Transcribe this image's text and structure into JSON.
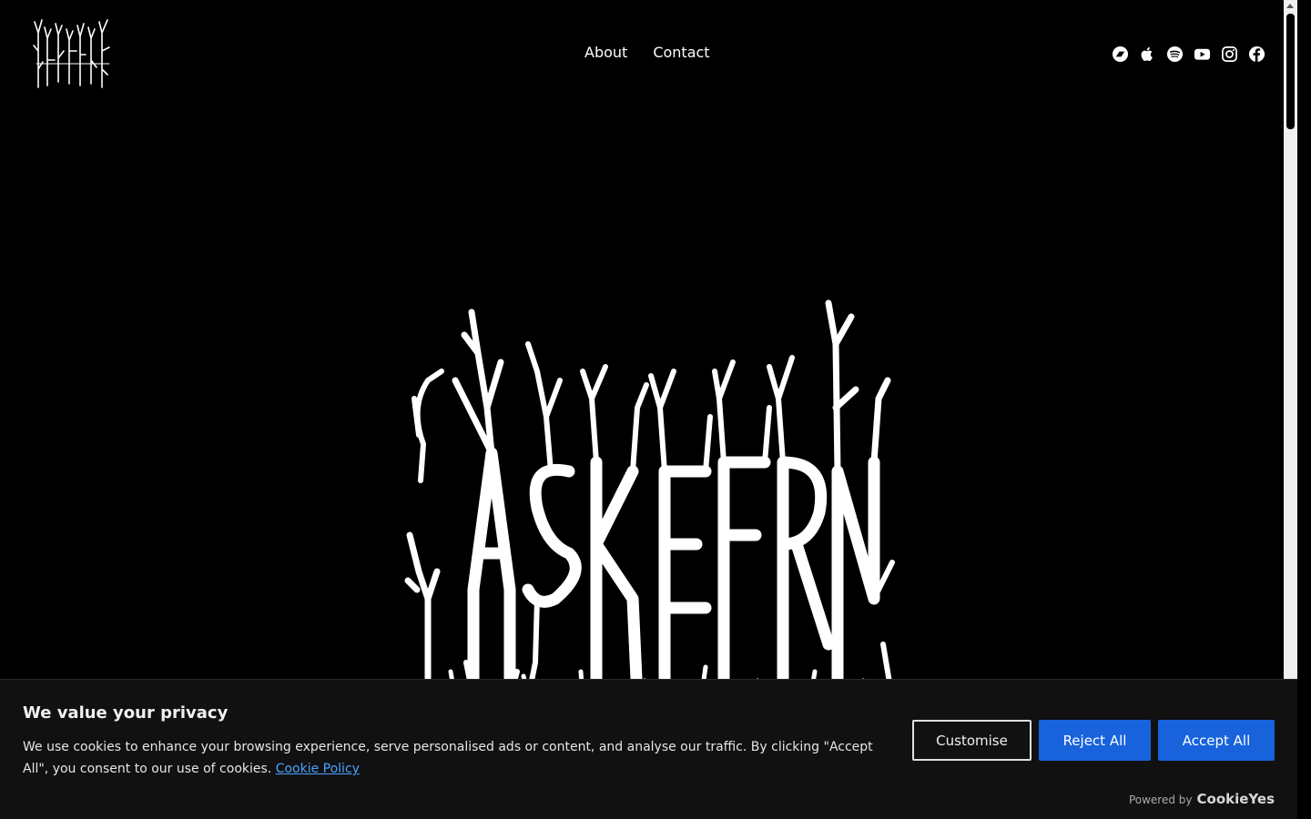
{
  "nav": {
    "about": "About",
    "contact": "Contact"
  },
  "brand": {
    "logo_text": "ASKEFRON"
  },
  "socials": [
    {
      "name": "bandcamp-icon"
    },
    {
      "name": "apple-music-icon"
    },
    {
      "name": "spotify-icon"
    },
    {
      "name": "youtube-icon"
    },
    {
      "name": "instagram-icon"
    },
    {
      "name": "facebook-icon"
    }
  ],
  "cookie": {
    "title": "We value your privacy",
    "text": "We use cookies to enhance your browsing experience, serve personalised ads or content, and analyse our traffic. By clicking \"Accept All\", you consent to our use of cookies.",
    "link": "Cookie Policy",
    "customise": "Customise",
    "reject": "Reject All",
    "accept": "Accept All",
    "powered_by": "Powered by",
    "powered_brand": "CookieYes"
  },
  "colors": {
    "background": "#000000",
    "accent": "#1863dc",
    "link": "#4aa3ff"
  }
}
